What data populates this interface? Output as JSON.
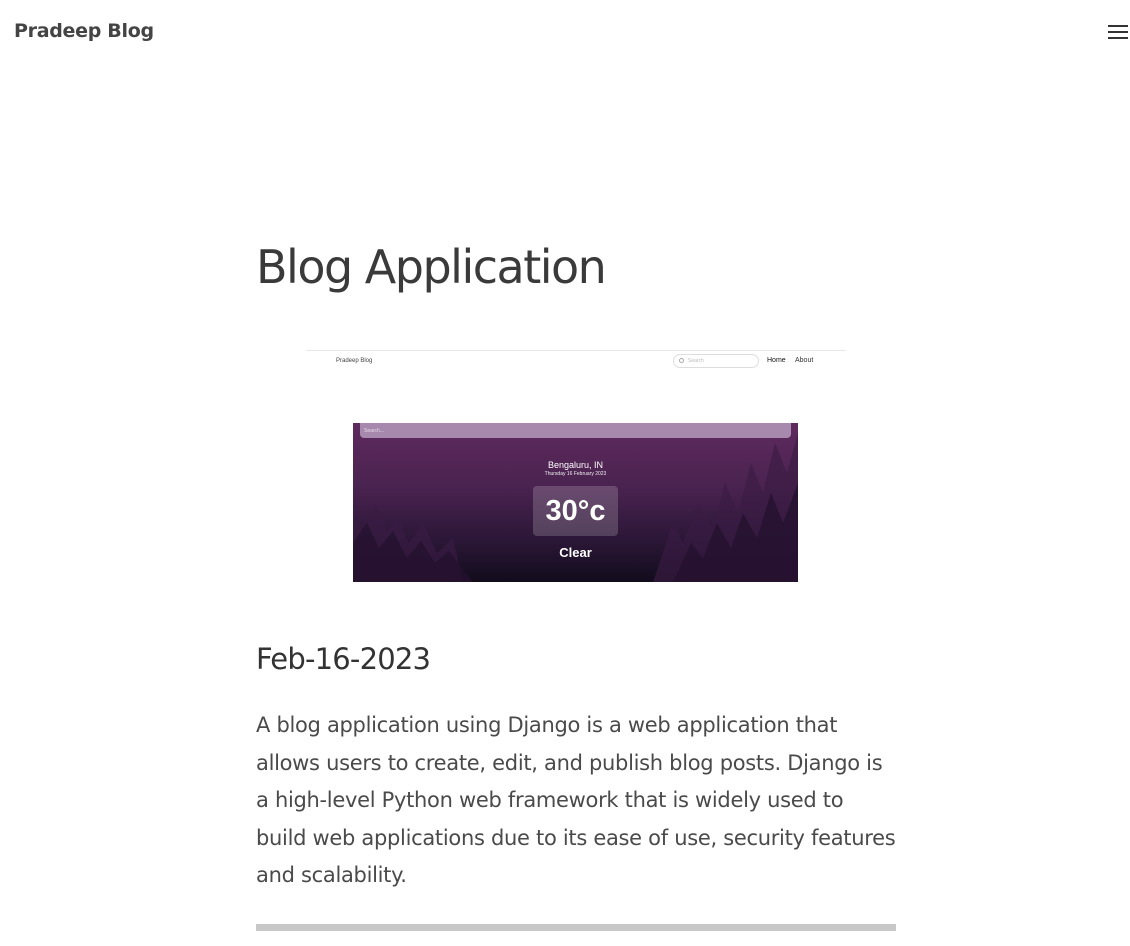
{
  "navbar": {
    "brand": "Pradeep Blog",
    "menu_icon": "hamburger-menu-icon"
  },
  "post": {
    "title": "Blog Application",
    "date": "Feb-16-2023",
    "body": "A blog application using Django is a web application that allows users to create, edit, and publish blog posts. Django is a high-level Python web framework that is widely used to build web applications due to its ease of use, security features and scalability."
  },
  "screenshot": {
    "brand": "Pradeep Blog",
    "search_placeholder": "Search",
    "nav_home": "Home",
    "nav_about": "About",
    "weather": {
      "search_placeholder": "Search...",
      "city": "Bengaluru, IN",
      "date": "Thursday 16 February 2023",
      "temperature": "30°c",
      "condition": "Clear"
    }
  },
  "colors": {
    "weather_gradient_top": "#5e2a5e",
    "weather_gradient_bottom": "#120c1c",
    "divider": "#c8c8c8"
  }
}
